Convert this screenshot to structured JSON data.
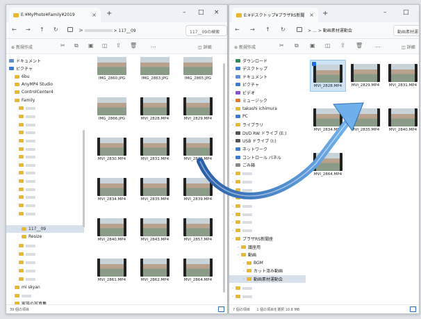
{
  "left_window": {
    "tab_title": "E:¥MyPhoto¥Family¥2019",
    "close": "×",
    "new_tab": "+",
    "win_min": "–",
    "win_max": "□",
    "win_close": "×",
    "nav_back": "←",
    "nav_forward": "→",
    "nav_up": "↑",
    "refresh": "↻",
    "path_sep": ">",
    "path_end": "117__09",
    "search_placeholder": "117__09の検索",
    "new_label": "新規作成",
    "detail_label": "詳細",
    "more": "…",
    "sidebar": [
      {
        "label": "ドキュメント"
      },
      {
        "label": "ピクチャ"
      },
      {
        "label": "6bu"
      },
      {
        "label": "AnyMP4 Studio"
      },
      {
        "label": "ControlCenter4"
      },
      {
        "label": "Family"
      },
      {
        "label": "117__09"
      },
      {
        "label": "Resize"
      },
      {
        "label": "mi skyan"
      },
      {
        "label": "家族の写真集"
      },
      {
        "label": "fontotakaro"
      }
    ],
    "files": [
      "IMG_2860.JPG",
      "IMG_2863.JPG",
      "IMG_2865.JPG",
      "IMG_2866.JPG",
      "MVI_2828.MP4",
      "MVI_2829.MP4",
      "MVI_2830.MP4",
      "MVI_2831.MP4",
      "MVI_2832.MP4",
      "MVI_2834.MP4",
      "MVI_2835.MP4",
      "MVI_2839.MP4",
      "MVI_2840.MP4",
      "MVI_2843.MP4",
      "MVI_2857.MP4",
      "MVI_2861.MP4",
      "MVI_2862.MP4",
      "MVI_2864.MP4"
    ],
    "status": "39 個の項目"
  },
  "right_window": {
    "tab_title": "E:¥デスクトップ¥プラザRS新聞",
    "close": "×",
    "new_tab": "+",
    "win_min": "–",
    "win_max": "□",
    "nav_back": "←",
    "nav_forward": "→",
    "nav_up": "↑",
    "refresh": "↻",
    "path_sep": ">",
    "path_dots": "…",
    "path_end": "動画素材運動会",
    "search_placeholder": "動画素材運",
    "new_label": "新規作成",
    "detail_label": "詳細",
    "more": "…",
    "sidebar": [
      {
        "label": "ダウンロード"
      },
      {
        "label": "デスクトップ"
      },
      {
        "label": "ドキュメント"
      },
      {
        "label": "ピクチャ"
      },
      {
        "label": "ビデオ"
      },
      {
        "label": "ミュージック"
      },
      {
        "label": "takashi ichimura"
      },
      {
        "label": "PC"
      },
      {
        "label": "ライブラリ"
      },
      {
        "label": "DVD RW ドライブ (E:)"
      },
      {
        "label": "USB ドライブ (I:)"
      },
      {
        "label": "ネットワーク"
      },
      {
        "label": "コントロール パネル"
      },
      {
        "label": "ごみ箱"
      },
      {
        "label": "プラザRS新聞座"
      },
      {
        "label": "議座用"
      },
      {
        "label": "動画"
      },
      {
        "label": "BGM"
      },
      {
        "label": "カット済み動画"
      },
      {
        "label": "動画素材運動会"
      }
    ],
    "files": [
      "MVI_2828.MP4",
      "MVI_2829.MP4",
      "MVI_2831.MP4",
      "MVI_2834.MP4",
      "MVI_2835.MP4",
      "MVI_2840.MP4",
      "MVI_2864.MP4"
    ],
    "status_count": "7 個の項目",
    "status_sel": "1 個の項目を選択 10.8 MB"
  },
  "colors": {
    "arrow": "#2f6fb4",
    "folder": "#e8b830",
    "selection": "#cfe3f7"
  }
}
